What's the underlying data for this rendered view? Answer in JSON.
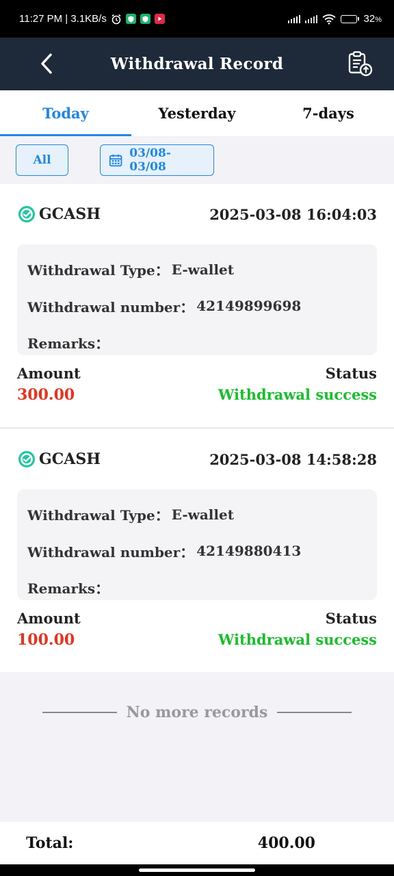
{
  "status_bar": {
    "time_speed": "11:27 PM | 3.1KB/s",
    "battery": "32",
    "battery_unit": "%",
    "battery_level": 0.32
  },
  "header": {
    "title": "Withdrawal Record"
  },
  "tabs": [
    {
      "label": "Today",
      "active": true
    },
    {
      "label": "Yesterday",
      "active": false
    },
    {
      "label": "7-days",
      "active": false
    }
  ],
  "filters": {
    "all_label": "All",
    "date_range": "03/08- 03/08"
  },
  "labels": {
    "withdrawal_type": "Withdrawal Type：",
    "withdrawal_number": "Withdrawal number：",
    "remarks": "Remarks：",
    "amount": "Amount",
    "status": "Status"
  },
  "records": [
    {
      "brand": "GCASH",
      "datetime": "2025-03-08 16:04:03",
      "type": "E-wallet",
      "number": "42149899698",
      "remarks": "",
      "amount": "300.00",
      "status": "Withdrawal success"
    },
    {
      "brand": "GCASH",
      "datetime": "2025-03-08 14:58:28",
      "type": "E-wallet",
      "number": "42149880413",
      "remarks": "",
      "amount": "100.00",
      "status": "Withdrawal success"
    }
  ],
  "no_more": "No more records",
  "total": {
    "label": "Total:",
    "value": "400.00"
  },
  "colors": {
    "header_bg": "#1e2a3a",
    "accent": "#1f87e5",
    "amount": "#e8321e",
    "success": "#17c02a",
    "gcash": "#1ec8a0"
  }
}
